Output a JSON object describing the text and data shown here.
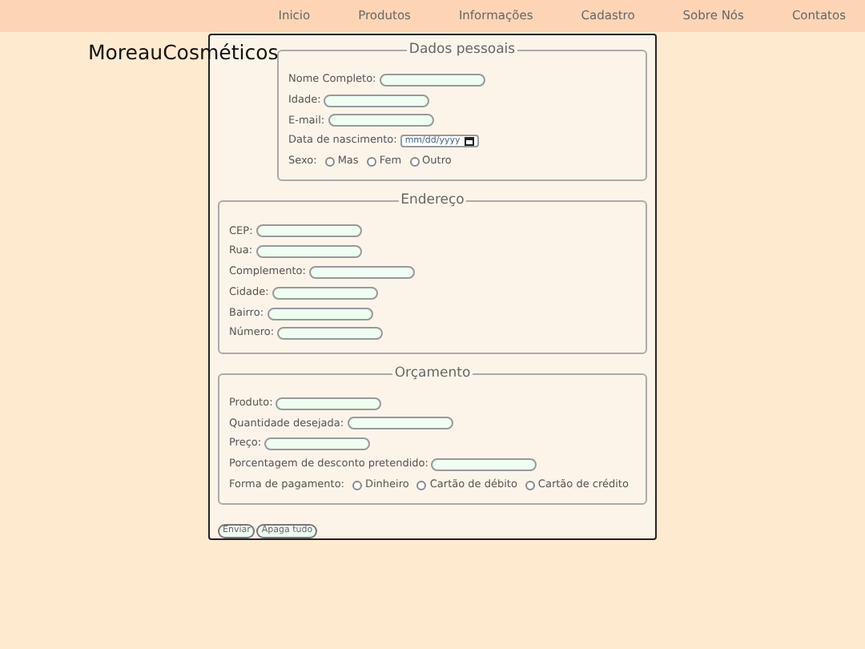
{
  "nav": {
    "items": [
      "Inicio",
      "Produtos",
      "Informações",
      "Cadastro",
      "Sobre Nós",
      "Contatos"
    ]
  },
  "logo": "MoreauCosméticos",
  "sections": [
    {
      "title": "Dados pessoais",
      "fields": [
        {
          "kind": "text",
          "label": "Nome Completo:"
        },
        {
          "kind": "text",
          "label": "Idade:"
        },
        {
          "kind": "text",
          "label": "E-mail:"
        },
        {
          "kind": "date",
          "label": "Data de nascimento:",
          "placeholder": "mm/dd/yyyy"
        },
        {
          "kind": "radio",
          "label": "Sexo:",
          "options": [
            {
              "label": "Mas",
              "selected": false
            },
            {
              "label": "Fem",
              "selected": false
            },
            {
              "label": "Outro",
              "selected": false
            }
          ]
        }
      ]
    },
    {
      "title": "Endereço",
      "fields": [
        {
          "kind": "text",
          "label": "CEP:"
        },
        {
          "kind": "text",
          "label": "Rua:"
        },
        {
          "kind": "text",
          "label": "Complemento:"
        },
        {
          "kind": "text",
          "label": "Cidade:"
        },
        {
          "kind": "text",
          "label": "Bairro:"
        },
        {
          "kind": "text",
          "label": "Número:"
        }
      ]
    },
    {
      "title": "Orçamento",
      "fields": [
        {
          "kind": "text",
          "label": "Produto:"
        },
        {
          "kind": "text",
          "label": "Quantidade desejada:"
        },
        {
          "kind": "text",
          "label": "Preço:"
        },
        {
          "kind": "text",
          "label": "Porcentagem de desconto pretendido:"
        },
        {
          "kind": "radio",
          "label": "Forma de pagamento:",
          "options": [
            {
              "label": "Dinheiro",
              "selected": false
            },
            {
              "label": "Cartão de débito",
              "selected": false
            },
            {
              "label": "Cartão de crédito",
              "selected": false
            }
          ]
        }
      ]
    }
  ],
  "buttons": [
    "Enviar",
    "Apaga tudo"
  ]
}
